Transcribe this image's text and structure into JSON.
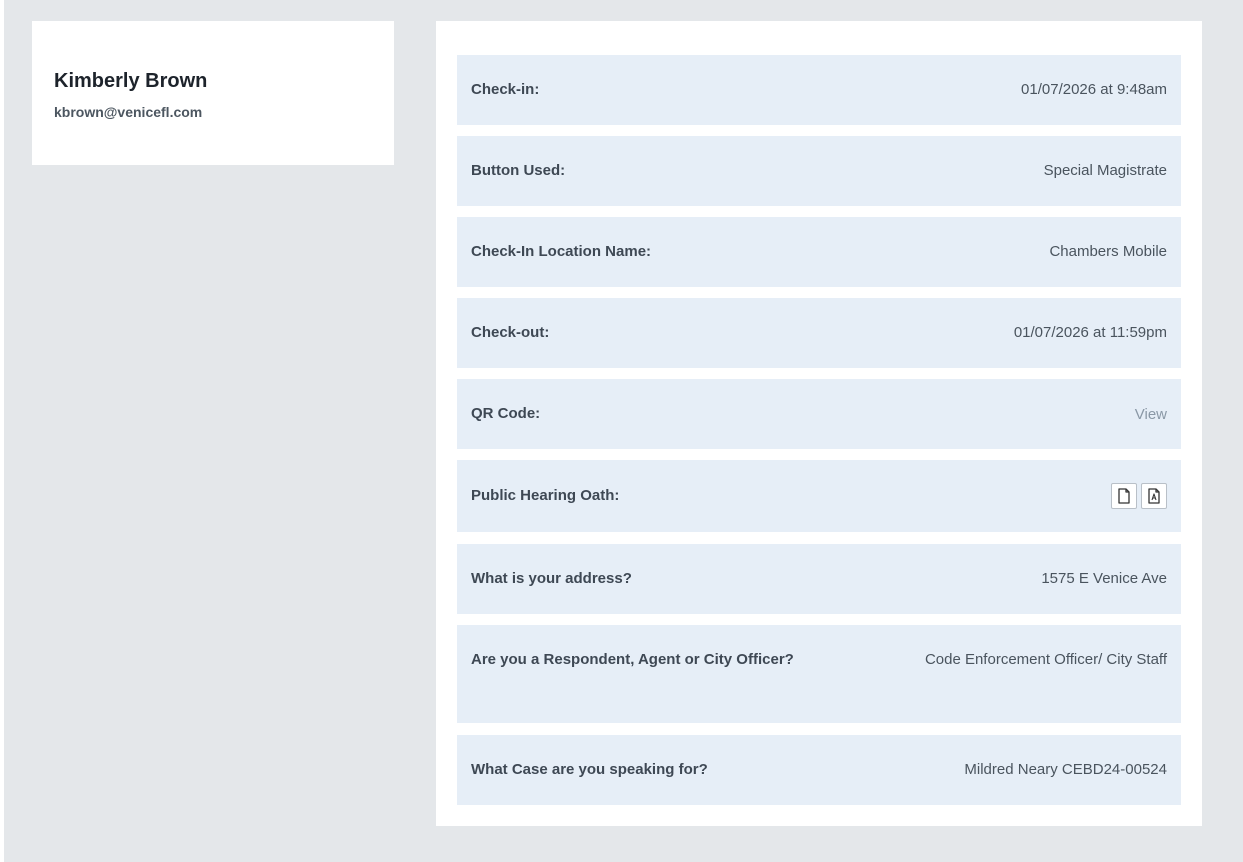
{
  "profile": {
    "name": "Kimberly Brown",
    "email": "kbrown@venicefl.com"
  },
  "details": {
    "check_in": {
      "label": "Check-in:",
      "value": "01/07/2026 at 9:48am"
    },
    "button_used": {
      "label": "Button Used:",
      "value": "Special Magistrate"
    },
    "location": {
      "label": "Check-In Location Name:",
      "value": "Chambers Mobile"
    },
    "check_out": {
      "label": "Check-out:",
      "value": "01/07/2026 at 11:59pm"
    },
    "qr_code": {
      "label": "QR Code:",
      "value": "View"
    },
    "oath": {
      "label": "Public Hearing Oath:",
      "icons": [
        "document-icon",
        "pdf-icon"
      ]
    },
    "address": {
      "label": "What is your address?",
      "value": "1575 E Venice Ave"
    },
    "role": {
      "label": "Are you a Respondent, Agent or City Officer?",
      "value": "Code Enforcement Officer/ City Staff"
    },
    "case": {
      "label": "What Case are you speaking for?",
      "value": "Mildred Neary CEBD24-00524"
    }
  },
  "colors": {
    "page_background": "#e4e7ea",
    "card_background": "#ffffff",
    "row_background": "#e6eef7",
    "link": "#8a98a6"
  }
}
